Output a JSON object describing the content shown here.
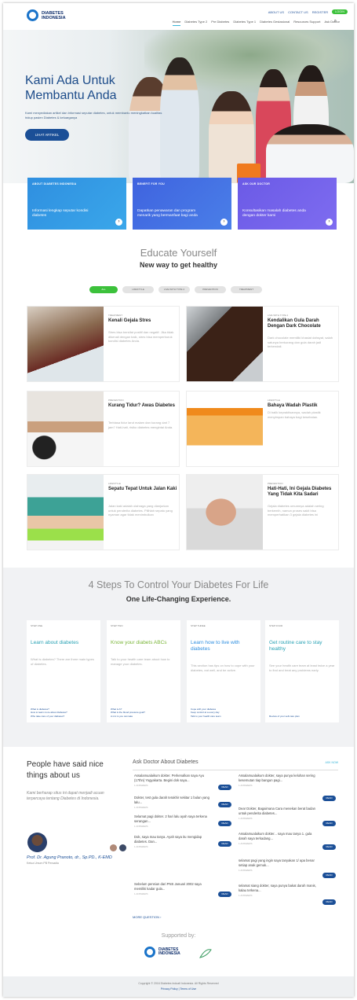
{
  "header": {
    "logo_text": "DIABETES INDONESIA",
    "top_links": [
      "ABOUT US",
      "CONTACT US",
      "REGISTER"
    ],
    "login": "LOGIN",
    "nav": [
      "Home",
      "Diabetes Type 2",
      "Pre Diabetes",
      "Diabetes Type 1",
      "Diabetes Gestasional",
      "Resources Support",
      "Ask Doctor"
    ]
  },
  "hero": {
    "title": "Kami Ada Untuk Membantu Anda",
    "description": "Kami menyediakan artikel dan informasi seputar diabetes, untuk membantu meningkatkan kualitas hidup pasien Diabetes & keluarganya",
    "button": "LIHAT ARTIKEL"
  },
  "cards": [
    {
      "title": "ABOUT DIABETES INDONESIA",
      "desc": "Informasi lengkap seputar kondisi diabetes",
      "color": "#2f8fe0"
    },
    {
      "title": "BENEFIT FOR YOU",
      "desc": "Dapatkan penawaran dan program menarik yang bermanfaat bagi anda",
      "color": "#3f63df"
    },
    {
      "title": "ASK OUR DOCTOR",
      "desc": "Konsultasikan masalah diabetes anda dengan dokter kami",
      "color": "#6b5ae6"
    }
  ],
  "educate": {
    "title": "Educate Yourself",
    "subtitle": "New way to get healthy",
    "filters": [
      "ALL",
      "LIFESTYLE",
      "LIVE WITH TYPE 2",
      "PREVENTION",
      "TREATMENT"
    ]
  },
  "articles": [
    {
      "category": "TREATMENT",
      "title": "Kenali Gejala Stres",
      "excerpt": "Stres bisa bersifat positif dan negatif. Jika tidak dikenali dengan baik, stres bisa memperburuk kondisi diabetes Anda."
    },
    {
      "category": "LIVE WITH TYPE 2",
      "title": "Kendalikan Gula Darah Dengan Dark Chocolate",
      "excerpt": "Dark chocolate memiliki khasiat dahsyat, salah satunya berkurang dan gula darah jadi terkendali."
    },
    {
      "category": "PREVENTION",
      "title": "Kurang Tidur? Awas Diabetes",
      "excerpt": "Terbiasa tidur larut malam dan kurang dari 7 jam? Hati-hati, risiko diabetes mengintai Anda."
    },
    {
      "category": "LIFESTYLE",
      "title": "Bahaya Wadah Plastik",
      "excerpt": "Di balik kepraktisannya, wadah plastik menyimpan bahaya bagi kesehatan."
    },
    {
      "category": "LIFESTYLE",
      "title": "Sepatu Tepat Untuk Jalan Kaki",
      "excerpt": "Jalan kaki adalah olahraga yang dianjurkan untuk penderita diabetes. Pilihlah sepatu yang nyaman agar tidak menimbulkan"
    },
    {
      "category": "PREVENTION",
      "title": "Hati-Hati, Ini Gejala Diabetes Yang Tidak Kita Sadari",
      "excerpt": "Gejala diabetes umumnya adalah sering berkemih, namun proses sakit bisa memperhatikan 3 gejala diabetes ini"
    }
  ],
  "steps": {
    "title": "4 Steps To Control Your Diabetes For Life",
    "subtitle": "One Life-Changing Experience.",
    "items": [
      {
        "label": "STEP ONE",
        "title": "Learn about diabetes",
        "desc": "What is diabetes? There are three main types of diabetes.",
        "links": [
          "What is diabetes?",
          "How to learn more about diabetes?",
          "Who take care of your diabetes?"
        ],
        "color": "#2ba3b5"
      },
      {
        "label": "STEP TWO",
        "title": "Know your diabets ABCs",
        "desc": "Talk to your health care team about how to manage your diabetes.",
        "links": [
          "What is A?",
          "What is the blood pressure goal?",
          "A mix is you can take"
        ],
        "color": "#7bb63a"
      },
      {
        "label": "STEP THREE",
        "title": "Learn how to live with diabetes",
        "desc": "This section has tips on how to cope with your diabetes, eat well, and be active.",
        "links": [
          "Cope with your diabetes",
          "Keep control at a every day",
          "Talk to your health care team"
        ],
        "color": "#2f8fe0"
      },
      {
        "label": "STEP FOUR",
        "title": "Get routine care to stay healthy",
        "desc": "See your health care team at least twice a year to find and treat any problems early.",
        "links": [
          "Review of your self-care plan"
        ],
        "color": "#2ba3b5"
      }
    ]
  },
  "testimonials": {
    "title": "People have said nice things about us",
    "quote": "Kami berharap situs ini dapat menjadi acuan terpercaya tentang Diabetes di Indonesia.",
    "name": "Prof. Dr. Agung Pranoto, dr., Sp.PD., K-EMD",
    "role": "Ketua Umum PB Persadia"
  },
  "ask": {
    "title": "Ask Doctor About Diabetes",
    "see_all": "ASK NOW",
    "read": "READ",
    "more": "MORE QUESTION",
    "questions": [
      {
        "text": "Assalamualaikum dokter. Perkenalkan saya Ayu (17thn) Yogyakarta. Begini dok saya...",
        "meta": "1 ANSWERS"
      },
      {
        "text": "Dokter, test gula darah terakhir sekitar 1 bulan yang lalu...",
        "meta": "1 ANSWERS"
      },
      {
        "text": "Selamat pagi dokter. 2 hari lalu ayah saya terkena serangan...",
        "meta": "1 ANSWERS"
      },
      {
        "text": "Dok, saya mau tanya. Ayah saya itu mengidap diabetes. Dan...",
        "meta": "1 ANSWERS"
      },
      {
        "text": "Sebelum pensiun dari PNS Januari 2002 saya memiliki kadar gula...",
        "meta": "1 ANSWERS"
      },
      {
        "text": "Assalamualaikum dokter, saya punya keluhan sering kesemutan tiap bangun pagi...",
        "meta": "1 ANSWERS"
      },
      {
        "text": "Dear Dokter, Bagaimana Cara menekan berat badan untuk penderita diabetes...",
        "meta": "1 ANSWERS"
      },
      {
        "text": "Assalamualaikum dokter... saya mau tanya 1. gula darah saya terkadang...",
        "meta": "1 ANSWERS"
      },
      {
        "text": "selamat pagi yang ingin saya tanyakan 1/ apa benar setiap anak gemuk...",
        "meta": "1 ANSWERS"
      },
      {
        "text": "selamat siang dokter, saya punya bakat darah manis, kalau terkena...",
        "meta": "1 ANSWERS"
      }
    ]
  },
  "supported": {
    "title": "Supported by:",
    "logo_text": "DIABETES INDONESIA"
  },
  "footer": {
    "copyright": "Copyright © 2016 Diabetes Indoatl Indonesia. All Rights Reserved",
    "policy": "Privacy Policy | Terms of Use"
  }
}
